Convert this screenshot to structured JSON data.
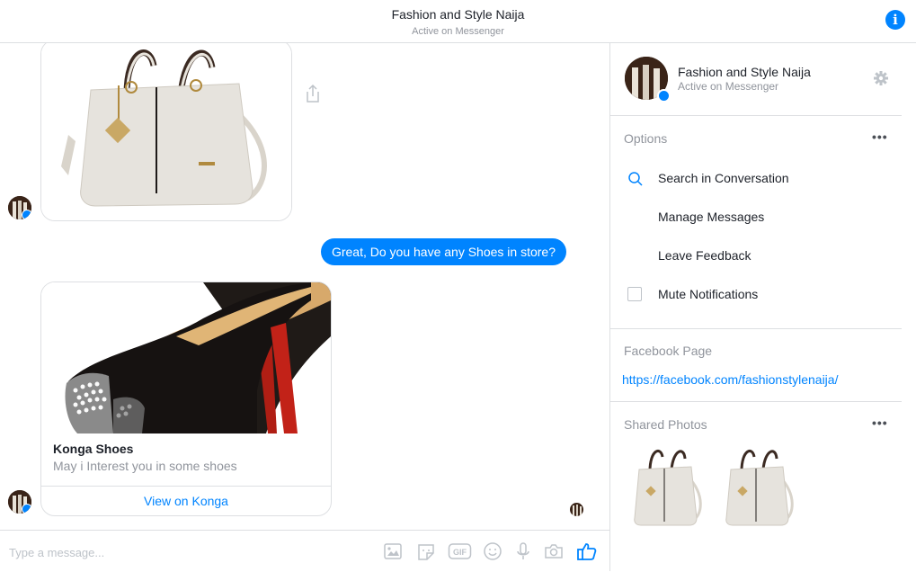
{
  "header": {
    "title": "Fashion and Style Naija",
    "subtitle": "Active on Messenger",
    "info_icon": "info-icon"
  },
  "conversation": {
    "messages": [
      {
        "type": "image-card",
        "sender": "page",
        "image": "handbag"
      },
      {
        "type": "text",
        "sender": "me",
        "text": "Great, Do you have any Shoes in store?"
      },
      {
        "type": "product-card",
        "sender": "page",
        "image": "heels",
        "title": "Konga Shoes",
        "subtitle": "May i Interest you in some shoes",
        "link_label": "View on Konga"
      }
    ]
  },
  "composer": {
    "placeholder": "Type a message...",
    "icons": [
      "photo-icon",
      "sticker-icon",
      "gif-icon",
      "emoji-icon",
      "microphone-icon",
      "camera-icon",
      "like-icon"
    ],
    "gif_text": "GIF"
  },
  "sidebar": {
    "name": "Fashion and Style Naija",
    "status": "Active on Messenger",
    "options": {
      "label": "Options",
      "items": [
        {
          "label": "Search in Conversation",
          "icon": "search-icon"
        },
        {
          "label": "Manage Messages"
        },
        {
          "label": "Leave Feedback"
        },
        {
          "label": "Mute Notifications",
          "icon": "checkbox",
          "checked": false
        }
      ]
    },
    "facebook_page": {
      "label": "Facebook Page",
      "url": "https://facebook.com/fashionstylenaija/"
    },
    "shared_photos": {
      "label": "Shared Photos",
      "count": 2
    },
    "more": "•••"
  },
  "colors": {
    "accent": "#0084ff",
    "text": "#1d2129",
    "muted": "#90949c",
    "border": "#dddfe2"
  }
}
